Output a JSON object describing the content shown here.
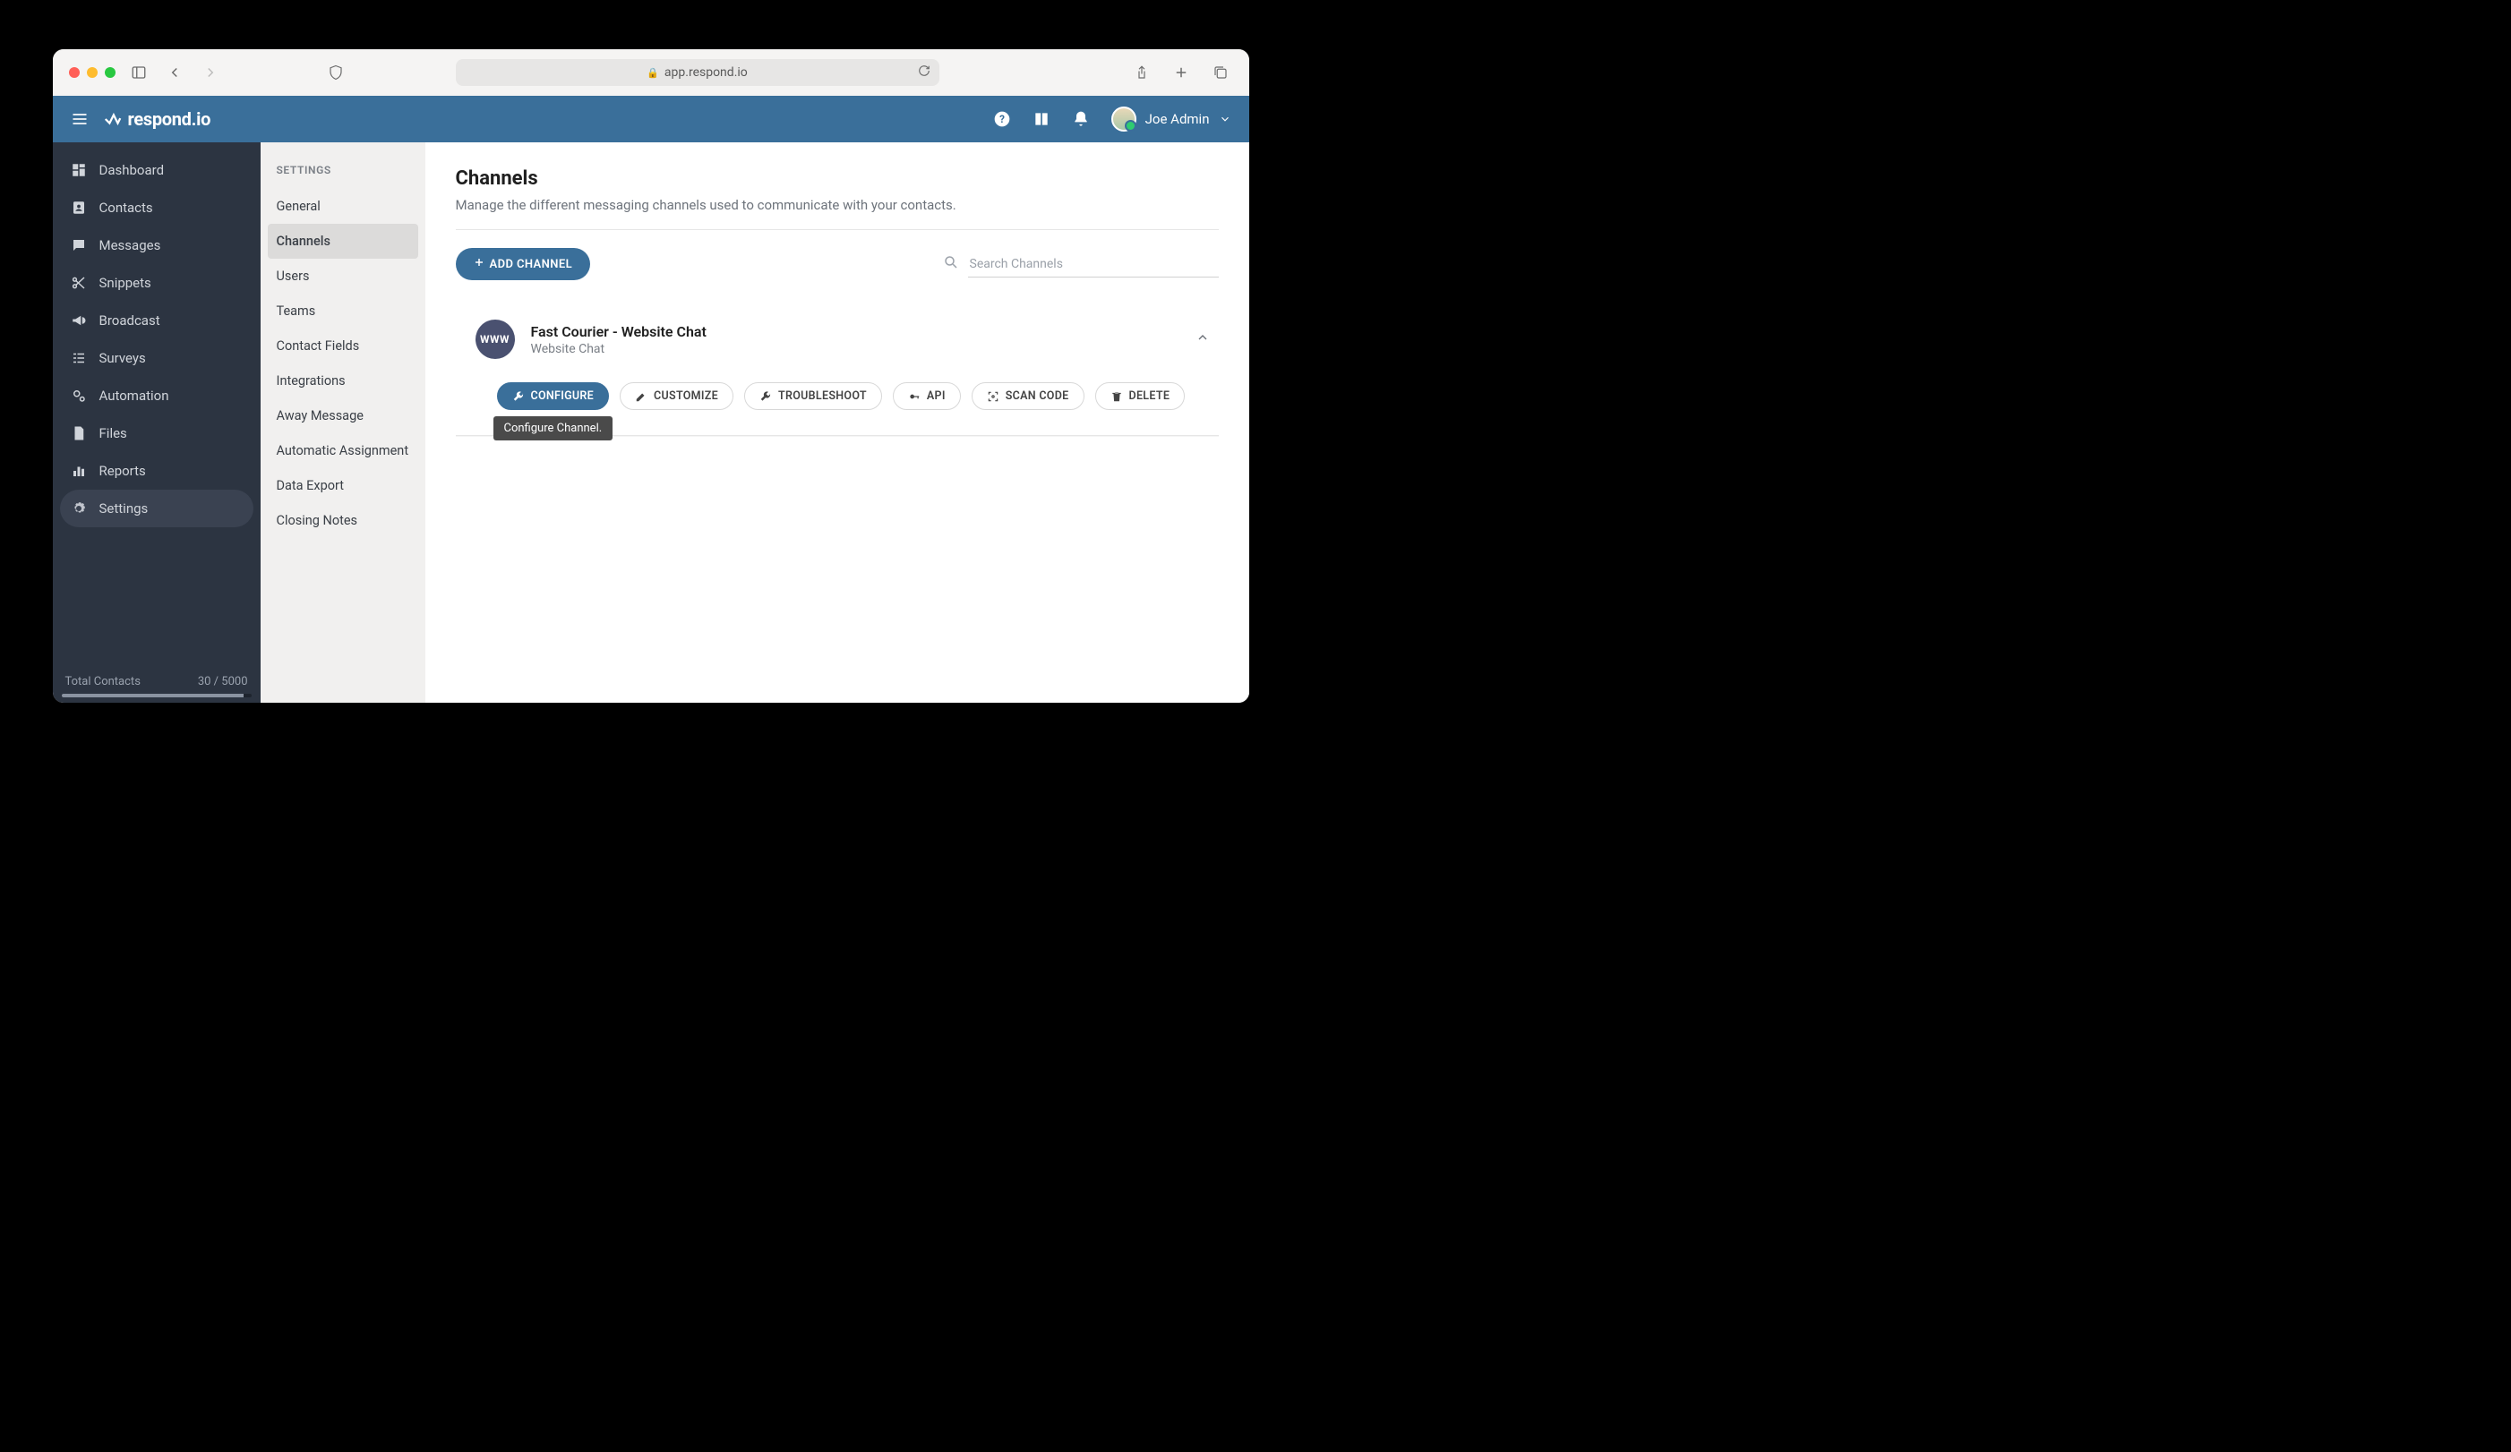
{
  "browser": {
    "url": "app.respond.io"
  },
  "topbar": {
    "logo_text": "respond.io",
    "user_name": "Joe Admin"
  },
  "sidebar1": {
    "items": [
      {
        "label": "Dashboard",
        "active": false
      },
      {
        "label": "Contacts",
        "active": false
      },
      {
        "label": "Messages",
        "active": false
      },
      {
        "label": "Snippets",
        "active": false
      },
      {
        "label": "Broadcast",
        "active": false
      },
      {
        "label": "Surveys",
        "active": false
      },
      {
        "label": "Automation",
        "active": false
      },
      {
        "label": "Files",
        "active": false
      },
      {
        "label": "Reports",
        "active": false
      },
      {
        "label": "Settings",
        "active": true
      }
    ],
    "footer_label": "Total Contacts",
    "footer_value": "30 / 5000"
  },
  "sidebar2": {
    "title": "SETTINGS",
    "items": [
      {
        "label": "General",
        "active": false
      },
      {
        "label": "Channels",
        "active": true
      },
      {
        "label": "Users",
        "active": false
      },
      {
        "label": "Teams",
        "active": false
      },
      {
        "label": "Contact Fields",
        "active": false
      },
      {
        "label": "Integrations",
        "active": false
      },
      {
        "label": "Away Message",
        "active": false
      },
      {
        "label": "Automatic Assignment",
        "active": false
      },
      {
        "label": "Data Export",
        "active": false
      },
      {
        "label": "Closing Notes",
        "active": false
      }
    ]
  },
  "main": {
    "title": "Channels",
    "subtitle": "Manage the different messaging channels used to communicate with your contacts.",
    "add_label": "ADD CHANNEL",
    "search_placeholder": "Search Channels",
    "channel": {
      "name": "Fast Courier - Website Chat",
      "type": "Website Chat",
      "icon_text": "WWW"
    },
    "actions": {
      "configure": "CONFIGURE",
      "customize": "CUSTOMIZE",
      "troubleshoot": "TROUBLESHOOT",
      "api": "API",
      "scan": "SCAN CODE",
      "delete": "DELETE"
    },
    "tooltip": "Configure Channel."
  }
}
